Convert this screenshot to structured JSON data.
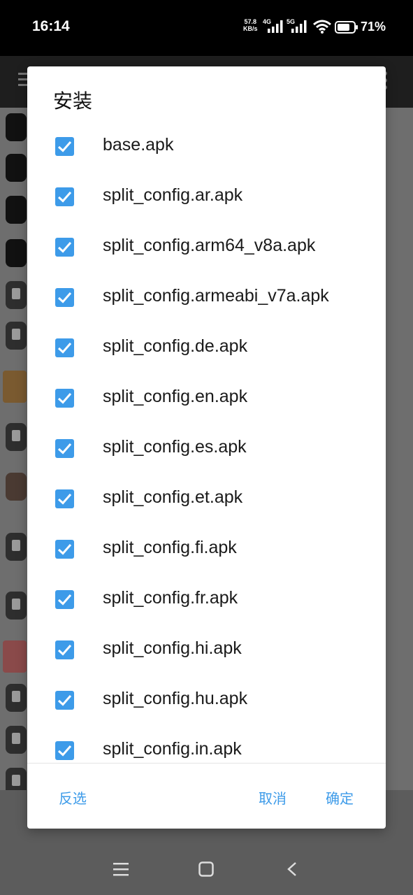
{
  "status_bar": {
    "time": "16:14",
    "network_speed": "57.8",
    "network_speed_unit": "KB/s",
    "sim1_type": "4G",
    "sim2_type": "5G",
    "battery_percent": "71%",
    "icons": [
      "signal-icon",
      "signal-icon",
      "wifi-icon",
      "battery-icon"
    ]
  },
  "dialog": {
    "title": "安装",
    "items": [
      {
        "label": "base.apk",
        "checked": true
      },
      {
        "label": "split_config.ar.apk",
        "checked": true
      },
      {
        "label": "split_config.arm64_v8a.apk",
        "checked": true
      },
      {
        "label": "split_config.armeabi_v7a.apk",
        "checked": true
      },
      {
        "label": "split_config.de.apk",
        "checked": true
      },
      {
        "label": "split_config.en.apk",
        "checked": true
      },
      {
        "label": "split_config.es.apk",
        "checked": true
      },
      {
        "label": "split_config.et.apk",
        "checked": true
      },
      {
        "label": "split_config.fi.apk",
        "checked": true
      },
      {
        "label": "split_config.fr.apk",
        "checked": true
      },
      {
        "label": "split_config.hi.apk",
        "checked": true
      },
      {
        "label": "split_config.hu.apk",
        "checked": true
      },
      {
        "label": "split_config.in.apk",
        "checked": true
      }
    ],
    "buttons": {
      "invert": "反选",
      "cancel": "取消",
      "confirm": "确定"
    }
  },
  "colors": {
    "accent": "#3d9be9",
    "scrim": "#5c5c5c",
    "dialog_bg": "#ffffff"
  },
  "nav_bar": {
    "icons": [
      "menu-icon",
      "home-icon",
      "back-icon"
    ]
  }
}
